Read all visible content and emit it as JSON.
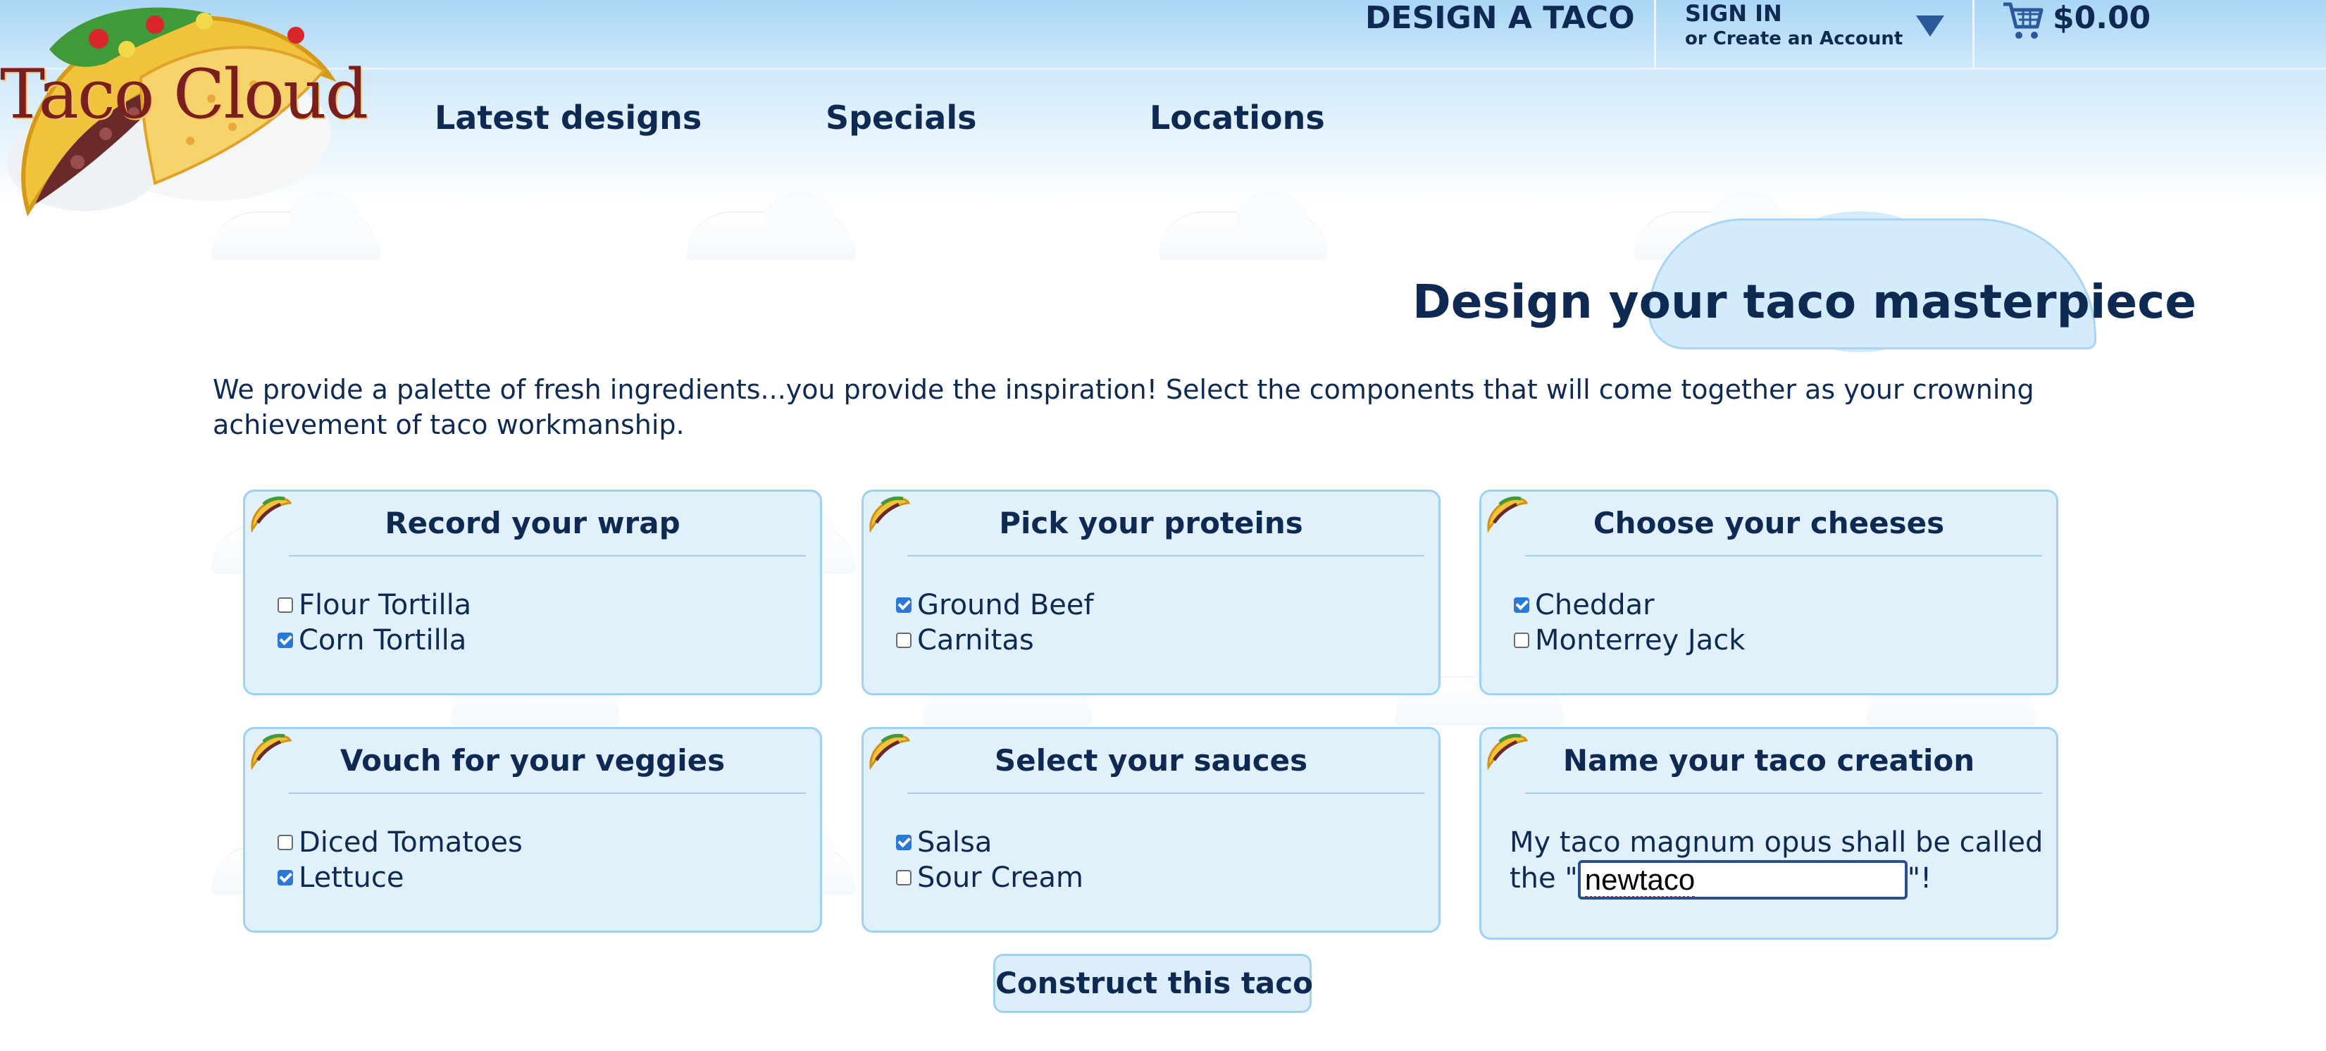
{
  "header": {
    "logo_text": "Taco Cloud",
    "design_link": "DESIGN A TACO",
    "sign_in": "SIGN IN",
    "create_account": "or Create an Account",
    "cart_total": "$0.00",
    "nav": [
      "Latest designs",
      "Specials",
      "Locations"
    ]
  },
  "main": {
    "title": "Design your taco masterpiece",
    "intro": "We provide a palette of fresh ingredients...you provide the inspiration! Select the components that will come together as your crowning achievement of taco workmanship."
  },
  "groups": [
    {
      "title": "Record your wrap",
      "options": [
        {
          "label": "Flour Tortilla",
          "checked": false
        },
        {
          "label": "Corn Tortilla",
          "checked": true
        }
      ]
    },
    {
      "title": "Pick your proteins",
      "options": [
        {
          "label": "Ground Beef",
          "checked": true
        },
        {
          "label": "Carnitas",
          "checked": false
        }
      ]
    },
    {
      "title": "Choose your cheeses",
      "options": [
        {
          "label": "Cheddar",
          "checked": true
        },
        {
          "label": "Monterrey Jack",
          "checked": false
        }
      ]
    },
    {
      "title": "Vouch for your veggies",
      "options": [
        {
          "label": "Diced Tomatoes",
          "checked": false
        },
        {
          "label": "Lettuce",
          "checked": true
        }
      ]
    },
    {
      "title": "Select your sauces",
      "options": [
        {
          "label": "Salsa",
          "checked": true
        },
        {
          "label": "Sour Cream",
          "checked": false
        }
      ]
    }
  ],
  "name_panel": {
    "title": "Name your taco creation",
    "prefix": "My taco magnum opus shall be called the \"",
    "value": "newtaco",
    "suffix": "\"!"
  },
  "submit_label": "Construct this taco",
  "colors": {
    "text": "#0f2a52",
    "panel_bg": "#def0fc",
    "panel_border": "#9fd2f2",
    "checkbox": "#2c78d6"
  }
}
